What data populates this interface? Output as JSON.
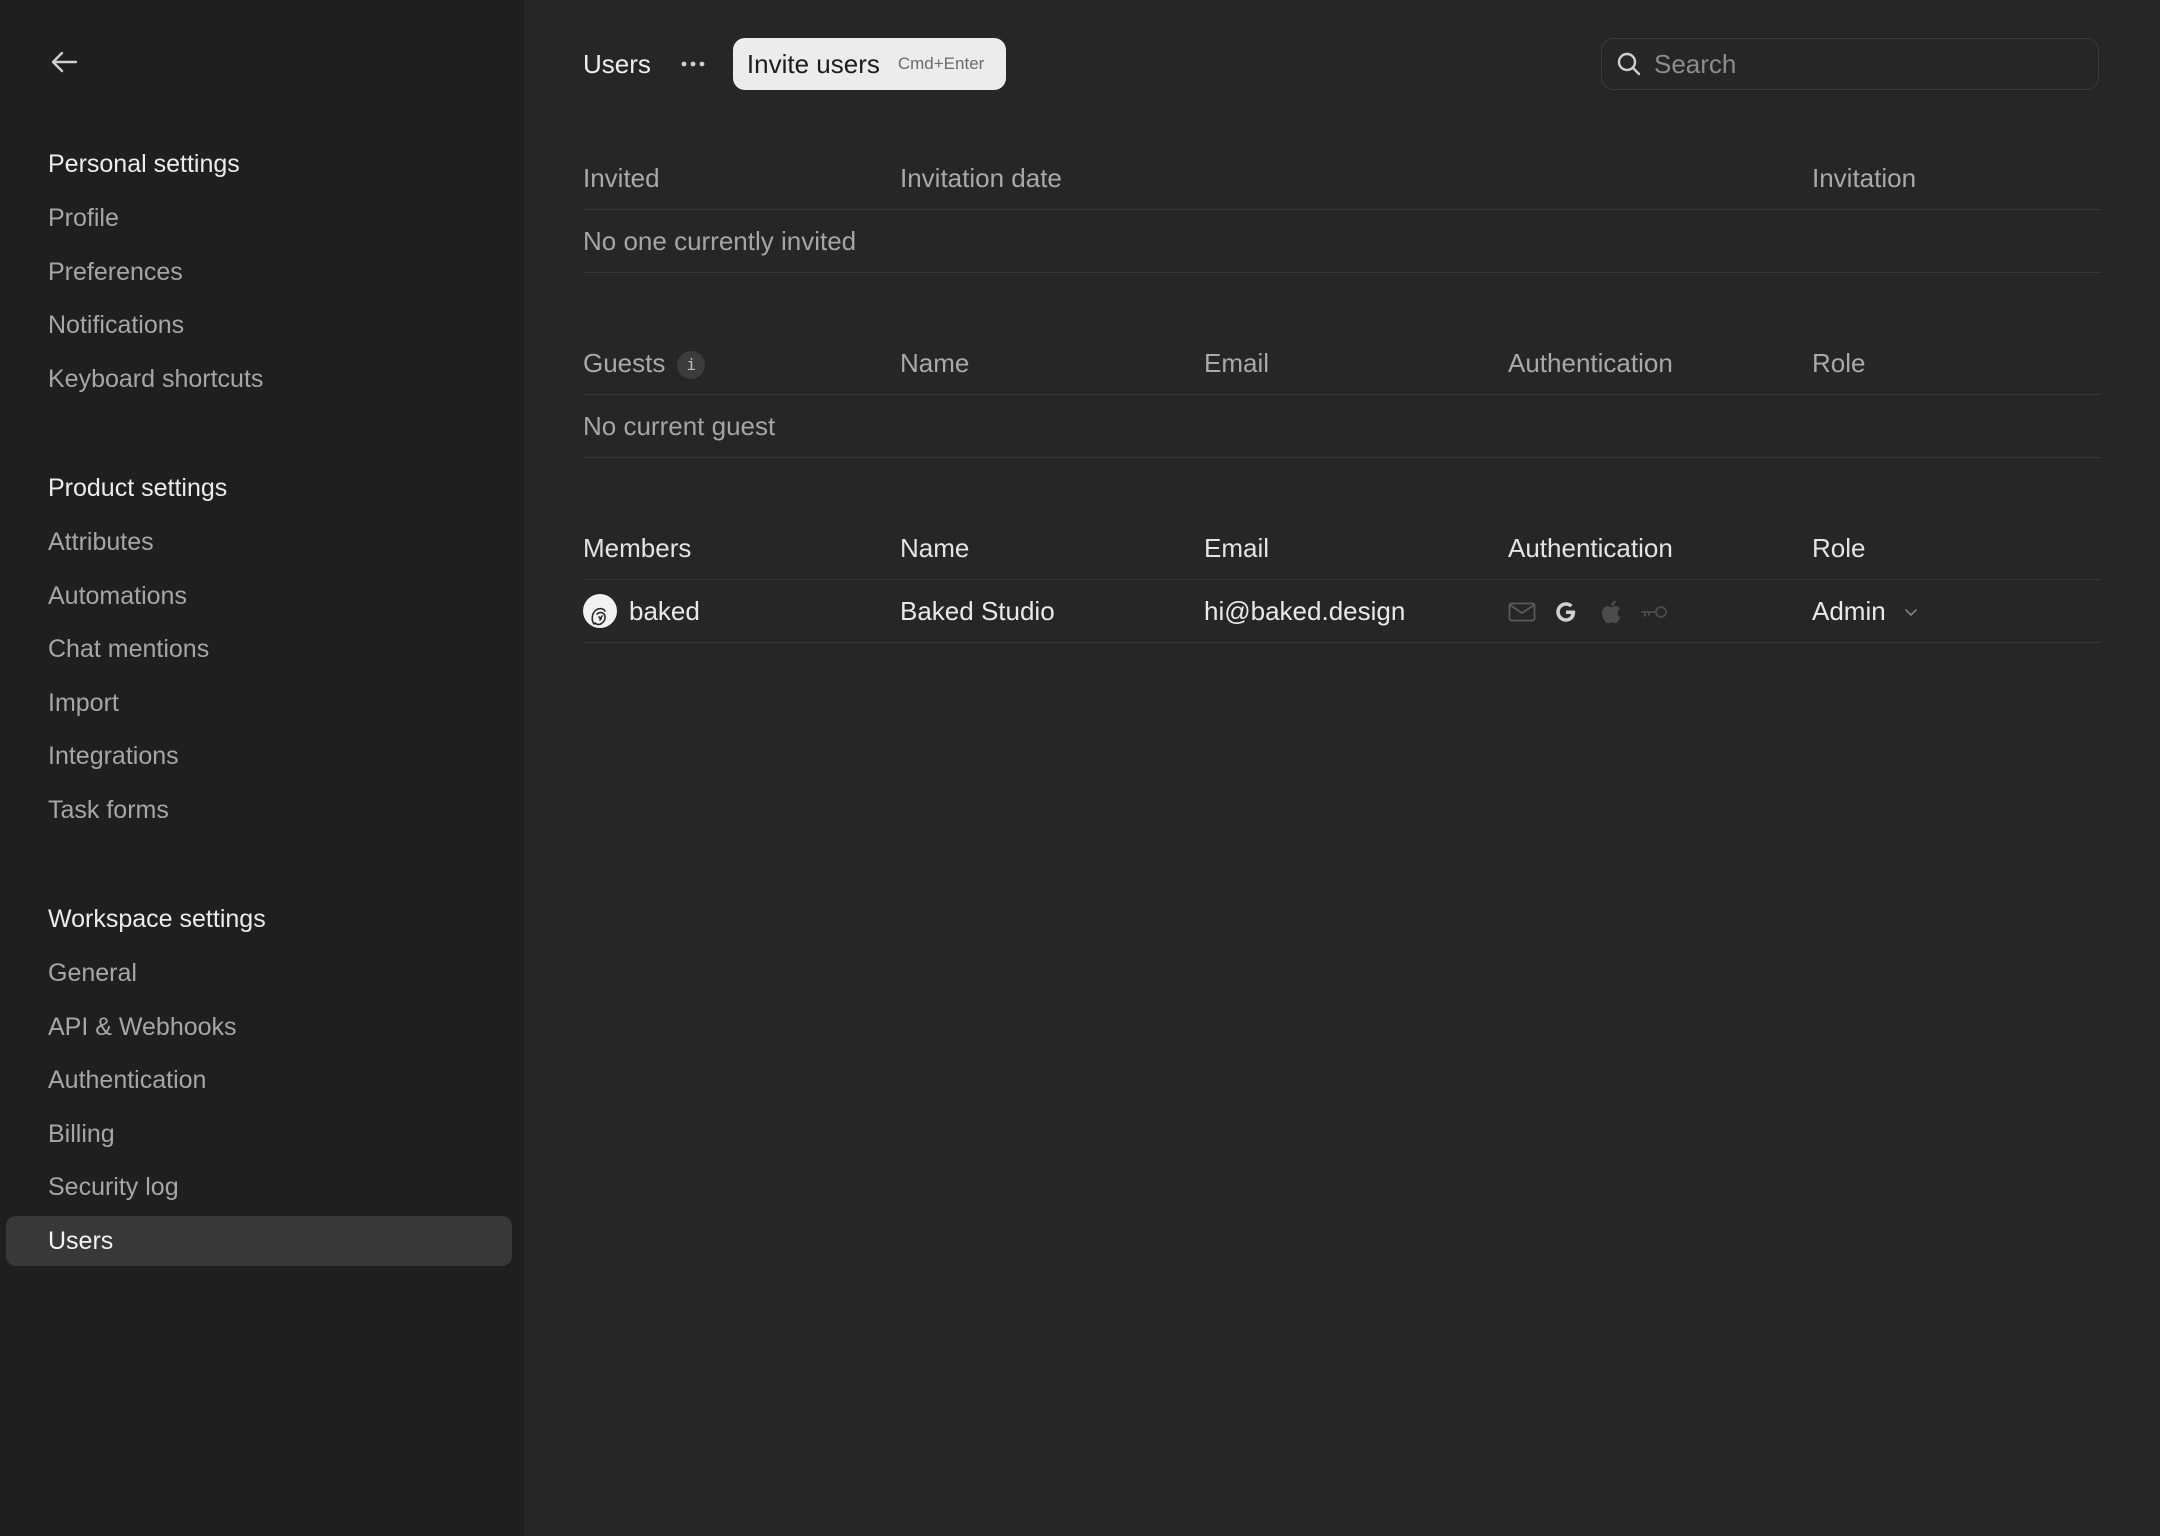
{
  "sidebar": {
    "personal": {
      "heading": "Personal settings",
      "items": [
        "Profile",
        "Preferences",
        "Notifications",
        "Keyboard shortcuts"
      ]
    },
    "product": {
      "heading": "Product settings",
      "items": [
        "Attributes",
        "Automations",
        "Chat mentions",
        "Import",
        "Integrations",
        "Task forms"
      ]
    },
    "workspace": {
      "heading": "Workspace settings",
      "items": [
        "General",
        "API & Webhooks",
        "Authentication",
        "Billing",
        "Security log",
        "Users"
      ],
      "active": "Users"
    }
  },
  "header": {
    "title": "Users",
    "invite_label": "Invite users",
    "invite_shortcut": "Cmd+Enter",
    "search_placeholder": "Search"
  },
  "invited": {
    "columns": [
      "Invited",
      "Invitation date",
      "Invitation"
    ],
    "empty_text": "No one currently invited"
  },
  "guests": {
    "columns": [
      "Guests",
      "Name",
      "Email",
      "Authentication",
      "Role"
    ],
    "info_glyph": "i",
    "empty_text": "No current guest"
  },
  "members": {
    "columns": [
      "Members",
      "Name",
      "Email",
      "Authentication",
      "Role"
    ],
    "rows": [
      {
        "username": "baked",
        "name": "Baked Studio",
        "email": "hi@baked.design",
        "auth_icons": [
          "mail-icon",
          "google-icon",
          "apple-icon",
          "key-icon"
        ],
        "role": "Admin"
      }
    ]
  },
  "colors": {
    "background": "#262626",
    "sidebar": "#1f1f1f",
    "active_item": "#383838",
    "invite_button": "#ececec"
  }
}
